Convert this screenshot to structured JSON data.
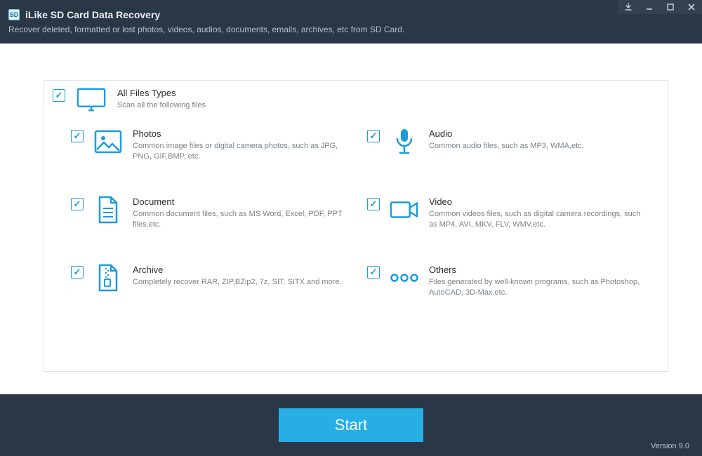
{
  "app": {
    "title": "iLike SD Card Data Recovery",
    "subtitle": "Recover deleted, formatted or lost photos, videos, audios, documents, emails, archives, etc from SD Card."
  },
  "all": {
    "title": "All Files Types",
    "desc": "Scan all the following files"
  },
  "categories": [
    {
      "title": "Photos",
      "desc": "Common image files or digital camera photos, such as JPG, PNG, GIF,BMP, etc."
    },
    {
      "title": "Audio",
      "desc": "Common audio files, such as MP3, WMA,etc."
    },
    {
      "title": "Document",
      "desc": "Common document files, such as MS Word, Excel, PDF, PPT files,etc."
    },
    {
      "title": "Video",
      "desc": "Common videos files, such as digital camera recordings, such as MP4, AVI, MKV, FLV, WMV,etc."
    },
    {
      "title": "Archive",
      "desc": "Completely recover RAR, ZIP,BZip2, 7z, SIT, SITX and more."
    },
    {
      "title": "Others",
      "desc": "Files generated by well-known programs, such as Photoshop, AutoCAD, 3D-Max,etc."
    }
  ],
  "startLabel": "Start",
  "version": "Version 9.0",
  "colors": {
    "accent": "#1b9be0",
    "header": "#2a3746"
  }
}
